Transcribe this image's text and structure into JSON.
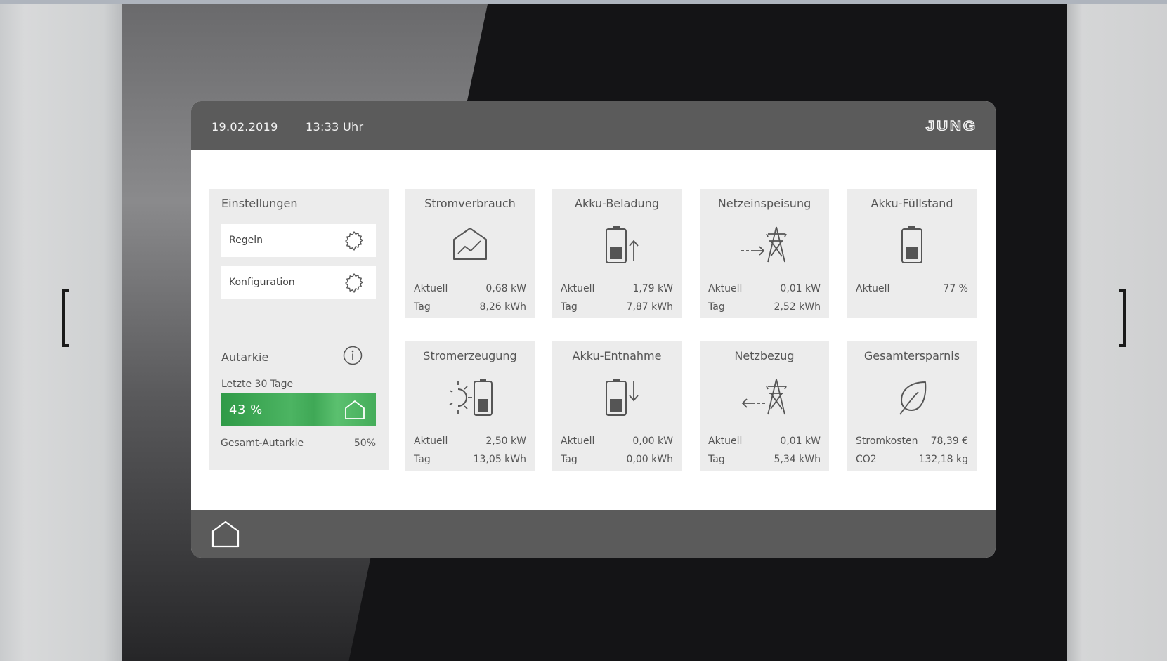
{
  "header": {
    "date": "19.02.2019",
    "time": "13:33 Uhr",
    "brand": "JUNG"
  },
  "settings": {
    "title": "Einstellungen",
    "buttons": [
      {
        "label": "Regeln",
        "icon": "gear-icon"
      },
      {
        "label": "Konfiguration",
        "icon": "gear-icon"
      }
    ],
    "autarkie": {
      "title": "Autarkie",
      "period": "Letzte 30 Tage",
      "value_label": "43 %",
      "value_fraction": 0.43,
      "total_label": "Gesamt-Autarkie",
      "total_value": "50%"
    }
  },
  "tiles": [
    {
      "title": "Stromverbrauch",
      "icon": "house-chart-icon",
      "rows": [
        {
          "k": "Aktuell",
          "v": "0,68 kW"
        },
        {
          "k": "Tag",
          "v": "8,26 kWh"
        }
      ]
    },
    {
      "title": "Akku-Beladung",
      "icon": "battery-charge-icon",
      "rows": [
        {
          "k": "Aktuell",
          "v": "1,79 kW"
        },
        {
          "k": "Tag",
          "v": "7,87 kWh"
        }
      ]
    },
    {
      "title": "Netzeinspeisung",
      "icon": "grid-feed-in-icon",
      "rows": [
        {
          "k": "Aktuell",
          "v": "0,01 kW"
        },
        {
          "k": "Tag",
          "v": "2,52 kWh"
        }
      ]
    },
    {
      "title": "Akku-Füllstand",
      "icon": "battery-level-icon",
      "rows": [
        {
          "k": "Aktuell",
          "v": "77 %"
        }
      ]
    },
    {
      "title": "Stromerzeugung",
      "icon": "solar-battery-icon",
      "rows": [
        {
          "k": "Aktuell",
          "v": "2,50 kW"
        },
        {
          "k": "Tag",
          "v": "13,05 kWh"
        }
      ]
    },
    {
      "title": "Akku-Entnahme",
      "icon": "battery-discharge-icon",
      "rows": [
        {
          "k": "Aktuell",
          "v": "0,00 kW"
        },
        {
          "k": "Tag",
          "v": "0,00 kWh"
        }
      ]
    },
    {
      "title": "Netzbezug",
      "icon": "grid-draw-icon",
      "rows": [
        {
          "k": "Aktuell",
          "v": "0,01 kW"
        },
        {
          "k": "Tag",
          "v": "5,34 kWh"
        }
      ]
    },
    {
      "title": "Gesamtersparnis",
      "icon": "leaf-icon",
      "rows": [
        {
          "k": "Stromkosten",
          "v": "78,39 €"
        },
        {
          "k": "CO2",
          "v": "132,18 kg"
        }
      ]
    }
  ],
  "colors": {
    "bar": "#5b5b5b",
    "tile": "#ececec",
    "accent_green": "#3fa856",
    "text": "#555555"
  }
}
